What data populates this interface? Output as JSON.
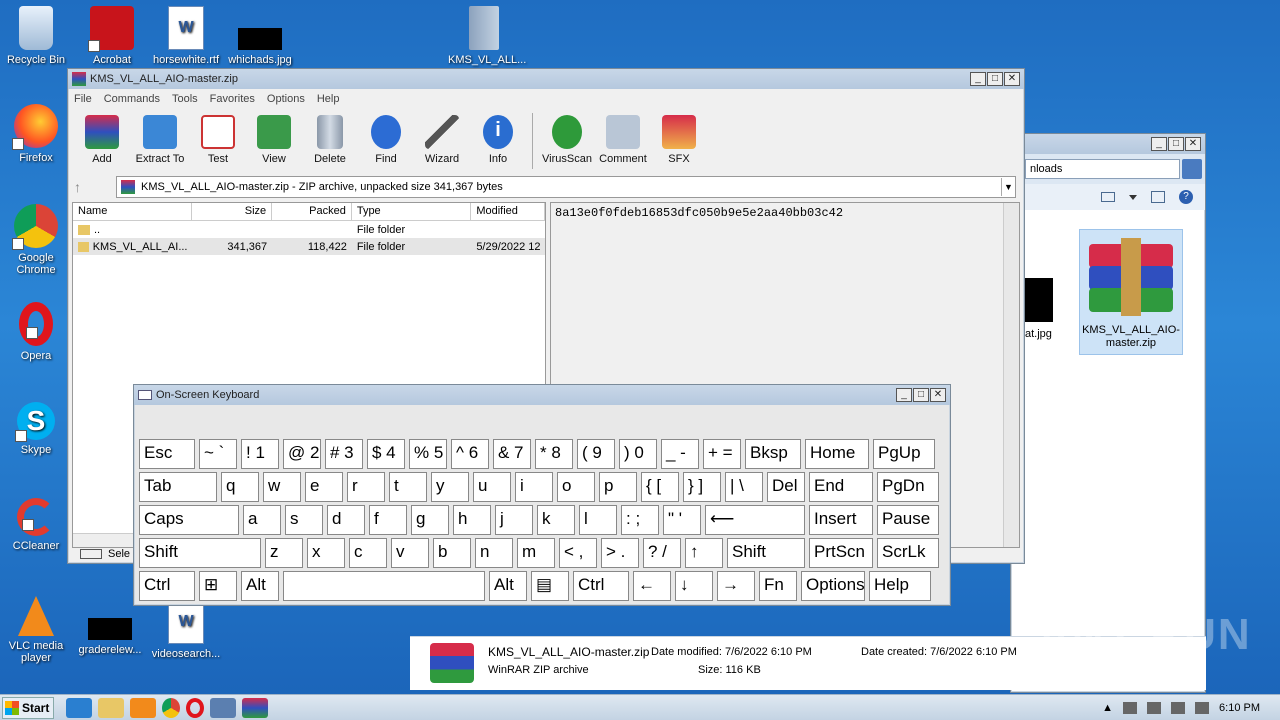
{
  "desktop": {
    "icons": [
      {
        "label": "Recycle Bin"
      },
      {
        "label": "Firefox"
      },
      {
        "label": "Google Chrome"
      },
      {
        "label": "Opera"
      },
      {
        "label": "Skype"
      },
      {
        "label": "CCleaner"
      },
      {
        "label": "VLC media player"
      },
      {
        "label": "Acrobat"
      },
      {
        "label": "horsewhite.rtf"
      },
      {
        "label": "whichads.jpg"
      },
      {
        "label": "KMS_VL_ALL..."
      },
      {
        "label": "graderelew..."
      },
      {
        "label": "videosearch..."
      }
    ]
  },
  "winrar": {
    "title": "KMS_VL_ALL_AIO-master.zip",
    "menu": [
      "File",
      "Commands",
      "Tools",
      "Favorites",
      "Options",
      "Help"
    ],
    "toolbar": [
      "Add",
      "Extract To",
      "Test",
      "View",
      "Delete",
      "Find",
      "Wizard",
      "Info",
      "VirusScan",
      "Comment",
      "SFX"
    ],
    "address": "KMS_VL_ALL_AIO-master.zip - ZIP archive, unpacked size 341,367 bytes",
    "columns": [
      "Name",
      "Size",
      "Packed",
      "Type",
      "Modified"
    ],
    "rows": [
      {
        "name": "..",
        "size": "",
        "packed": "",
        "type": "File folder",
        "modified": ""
      },
      {
        "name": "KMS_VL_ALL_AI...",
        "size": "341,367",
        "packed": "118,422",
        "type": "File folder",
        "modified": "5/29/2022 12"
      }
    ],
    "comment": "8a13e0f0fdeb16853dfc050b9e5e2aa40bb03c42",
    "status": "Sele"
  },
  "explorer": {
    "search_text": "nloads",
    "file_icon_label": "KMS_VL_ALL_AIO-master.zip",
    "partial_label": "at.jpg",
    "details": {
      "name": "KMS_VL_ALL_AIO-master.zip",
      "type": "WinRAR ZIP archive",
      "modified": "Date modified: 7/6/2022 6:10 PM",
      "created": "Date created: 7/6/2022 6:10 PM",
      "size": "Size: 116 KB"
    }
  },
  "osk": {
    "title": "On-Screen Keyboard",
    "rows": [
      [
        {
          "t": "Esc"
        },
        {
          "t": "~ `"
        },
        {
          "t": "! 1"
        },
        {
          "t": "@ 2"
        },
        {
          "t": "# 3"
        },
        {
          "t": "$ 4"
        },
        {
          "t": "% 5"
        },
        {
          "t": "^ 6"
        },
        {
          "t": "& 7"
        },
        {
          "t": "* 8"
        },
        {
          "t": "( 9"
        },
        {
          "t": ") 0"
        },
        {
          "t": "_ -"
        },
        {
          "t": "+ ="
        },
        {
          "t": "Bksp"
        },
        {
          "t": "Home"
        },
        {
          "t": "PgUp"
        }
      ],
      [
        {
          "t": "Tab"
        },
        {
          "t": "q"
        },
        {
          "t": "w"
        },
        {
          "t": "e"
        },
        {
          "t": "r"
        },
        {
          "t": "t"
        },
        {
          "t": "y"
        },
        {
          "t": "u"
        },
        {
          "t": "i"
        },
        {
          "t": "o"
        },
        {
          "t": "p"
        },
        {
          "t": "{ ["
        },
        {
          "t": "} ]"
        },
        {
          "t": "| \\"
        },
        {
          "t": "Del"
        },
        {
          "t": "End"
        },
        {
          "t": "PgDn"
        }
      ],
      [
        {
          "t": "Caps"
        },
        {
          "t": "a"
        },
        {
          "t": "s"
        },
        {
          "t": "d"
        },
        {
          "t": "f"
        },
        {
          "t": "g"
        },
        {
          "t": "h"
        },
        {
          "t": "j"
        },
        {
          "t": "k"
        },
        {
          "t": "l"
        },
        {
          "t": ": ;"
        },
        {
          "t": "\" '"
        },
        {
          "t": "⟵"
        },
        {
          "t": "Insert"
        },
        {
          "t": "Pause"
        }
      ],
      [
        {
          "t": "Shift"
        },
        {
          "t": "z"
        },
        {
          "t": "x"
        },
        {
          "t": "c"
        },
        {
          "t": "v"
        },
        {
          "t": "b"
        },
        {
          "t": "n"
        },
        {
          "t": "m"
        },
        {
          "t": "< ,"
        },
        {
          "t": "> ."
        },
        {
          "t": "? /"
        },
        {
          "t": "↑"
        },
        {
          "t": "Shift"
        },
        {
          "t": "PrtScn"
        },
        {
          "t": "ScrLk"
        }
      ],
      [
        {
          "t": "Ctrl"
        },
        {
          "t": "⊞"
        },
        {
          "t": "Alt"
        },
        {
          "t": ""
        },
        {
          "t": "Alt"
        },
        {
          "t": "▤"
        },
        {
          "t": "Ctrl"
        },
        {
          "t": "←"
        },
        {
          "t": "↓"
        },
        {
          "t": "→"
        },
        {
          "t": "Fn"
        },
        {
          "t": "Options"
        },
        {
          "t": "Help"
        }
      ]
    ]
  },
  "taskbar": {
    "start": "Start",
    "clock": "6:10 PM"
  },
  "watermark": "ANY RUN"
}
